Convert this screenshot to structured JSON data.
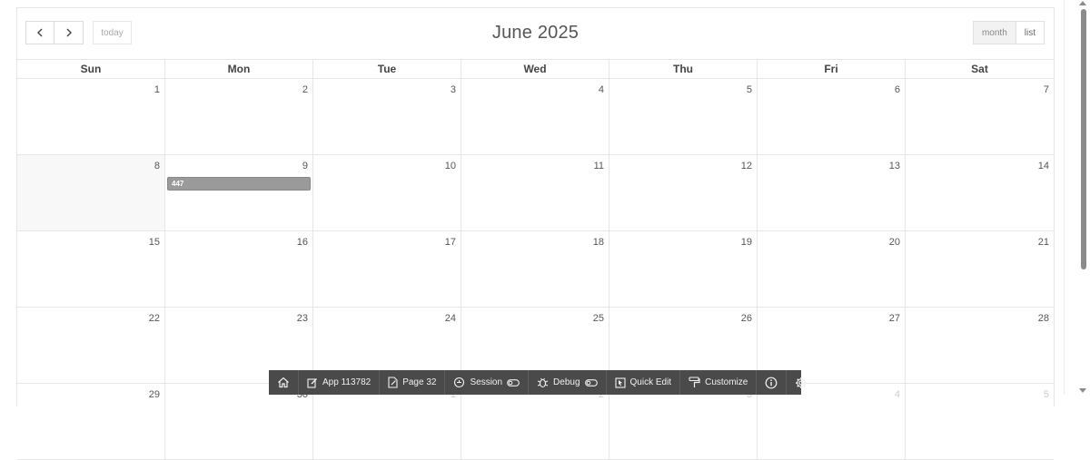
{
  "toolbar": {
    "prev_icon": "chevron-left-icon",
    "next_icon": "chevron-right-icon",
    "today_label": "today",
    "title": "June 2025",
    "views": [
      {
        "label": "month",
        "active": true
      },
      {
        "label": "list",
        "active": false
      }
    ]
  },
  "weekdays": [
    "Sun",
    "Mon",
    "Tue",
    "Wed",
    "Thu",
    "Fri",
    "Sat"
  ],
  "weeks": [
    [
      "1",
      "2",
      "3",
      "4",
      "5",
      "6",
      "7"
    ],
    [
      "8",
      "9",
      "10",
      "11",
      "12",
      "13",
      "14"
    ],
    [
      "15",
      "16",
      "17",
      "18",
      "19",
      "20",
      "21"
    ],
    [
      "22",
      "23",
      "24",
      "25",
      "26",
      "27",
      "28"
    ],
    [
      "29",
      "30",
      "1",
      "2",
      "3",
      "4",
      "5"
    ]
  ],
  "today_date": "8",
  "events": [
    {
      "title": "447",
      "date": "9",
      "color": "#9a9a9a"
    }
  ],
  "developer_toolbar": {
    "home_icon": "home-icon",
    "app_label": "App 113782",
    "page_label": "Page 32",
    "session_label": "Session",
    "debug_label": "Debug",
    "quick_edit_label": "Quick Edit",
    "customize_label": "Customize",
    "info_icon": "info-icon",
    "settings_icon": "gear-icon"
  },
  "colors": {
    "event": "#9a9a9a",
    "devbar": "#4a4a4a",
    "today_bg": "#f8f8f8"
  }
}
